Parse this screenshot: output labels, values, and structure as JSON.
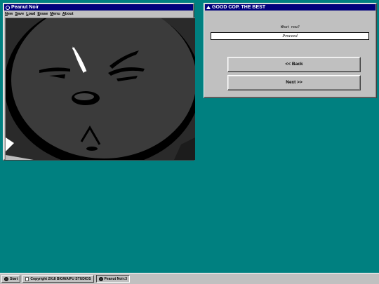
{
  "left_window": {
    "title": "Peanut Noir",
    "menu": [
      {
        "key": "N",
        "rest": "ew"
      },
      {
        "key": "S",
        "rest": "ave"
      },
      {
        "key": "L",
        "rest": "oad"
      },
      {
        "key": "E",
        "rest": "rase"
      },
      {
        "key": "M",
        "rest": "enu"
      },
      {
        "key": "A",
        "rest": "bout"
      }
    ],
    "scene": "close-up dark cartoon face with squinting eyes"
  },
  "right_window": {
    "title": "GOOD COP. THE BEST",
    "prompt_label": "What now?",
    "input_value": "Proceed",
    "back_label": "<< Back",
    "next_label": "Next >>"
  },
  "taskbar": {
    "start_label": "Start",
    "copyright_label": "Copyright 2018 BIGWAIFU STUDIOS",
    "task_label": "Peanut Noir:3"
  },
  "colors": {
    "desktop": "#008080",
    "title_bar": "#00007b",
    "window_face": "#c0c0c0"
  }
}
